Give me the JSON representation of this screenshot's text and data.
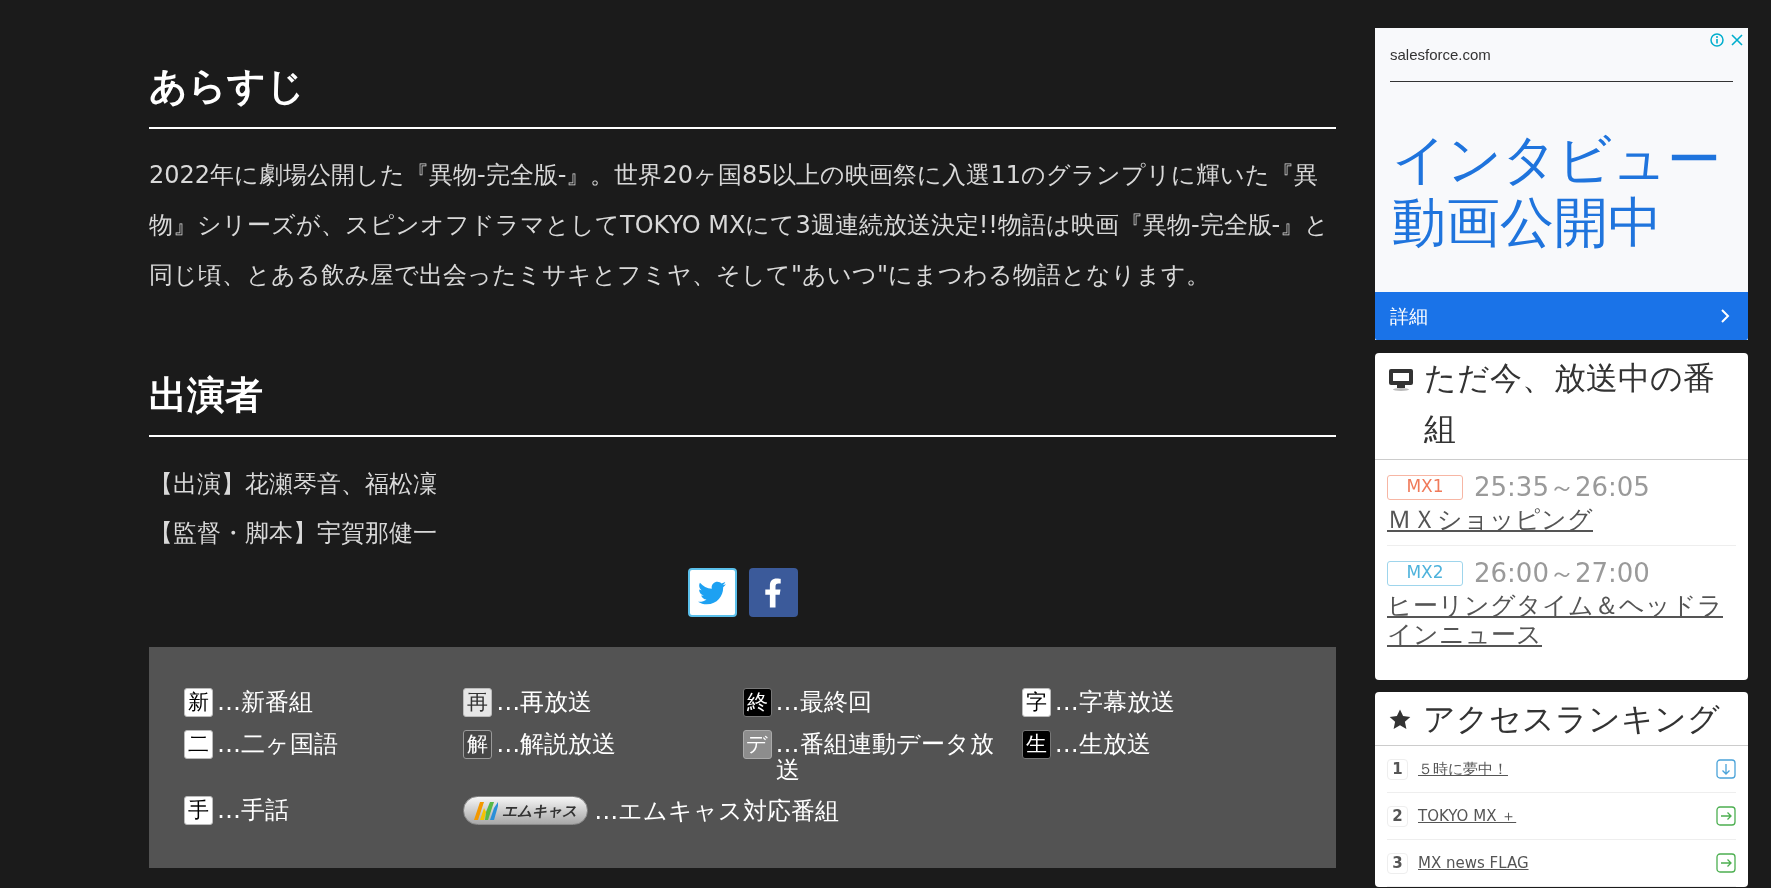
{
  "synopsis": {
    "heading": "あらすじ",
    "text": "2022年に劇場公開した『異物-完全版-』。世界20ヶ国85以上の映画祭に入選11のグランプリに輝いた『異物』シリーズが、スピンオフドラマとしてTOKYO MXにて3週連続放送決定!!物語は映画『異物-完全版-』と同じ頃、とある飲み屋で出会ったミサキとフミヤ、そして\"あいつ\"にまつわる物語となります。"
  },
  "cast": {
    "heading": "出演者",
    "lines": [
      "【出演】花瀬琴音、福松凜",
      "【監督・脚本】宇賀那健一"
    ]
  },
  "share_buttons": [
    {
      "kind": "twitter"
    },
    {
      "kind": "facebook"
    }
  ],
  "legend": {
    "items": [
      {
        "kind": "plain",
        "badge": "新",
        "label": "…新番組"
      },
      {
        "kind": "light",
        "badge": "再",
        "label": "…再放送"
      },
      {
        "kind": "inverse",
        "badge": "終",
        "label": "…最終回"
      },
      {
        "kind": "plain",
        "badge": "字",
        "label": "…字幕放送"
      },
      {
        "kind": "plain",
        "badge": "二",
        "label": "…二ヶ国語"
      },
      {
        "kind": "dark",
        "badge": "解",
        "label": "…解説放送"
      },
      {
        "kind": "gray",
        "badge": "デ",
        "label": "…番組連動データ放送"
      },
      {
        "kind": "inverse",
        "badge": "生",
        "label": "…生放送"
      },
      {
        "kind": "plain",
        "badge": "手",
        "label": "…手話"
      },
      {
        "kind": "logo",
        "badge": "エムキャス",
        "label": "…エムキャス対応番組"
      }
    ]
  },
  "ad": {
    "domain": "salesforce.com",
    "headline": "インタビュー動画公開中",
    "button": "詳細"
  },
  "now_on_air": {
    "title": "ただ今、放送中の番組",
    "programs": [
      {
        "channel": "MX1",
        "color": "#f07a5a",
        "time": "25:35～26:05",
        "title": "ＭＸショッピング"
      },
      {
        "channel": "MX2",
        "color": "#4fb3dc",
        "time": "26:00～27:00",
        "title": "ヒーリングタイム＆ヘッドラインニュース"
      }
    ]
  },
  "ranking": {
    "title": "アクセスランキング",
    "items": [
      {
        "rank": "1",
        "title": "５時に夢中！",
        "kind": "down"
      },
      {
        "rank": "2",
        "title": "TOKYO MX ＋",
        "kind": "right"
      },
      {
        "rank": "3",
        "title": "MX news FLAG",
        "kind": "right"
      }
    ]
  }
}
